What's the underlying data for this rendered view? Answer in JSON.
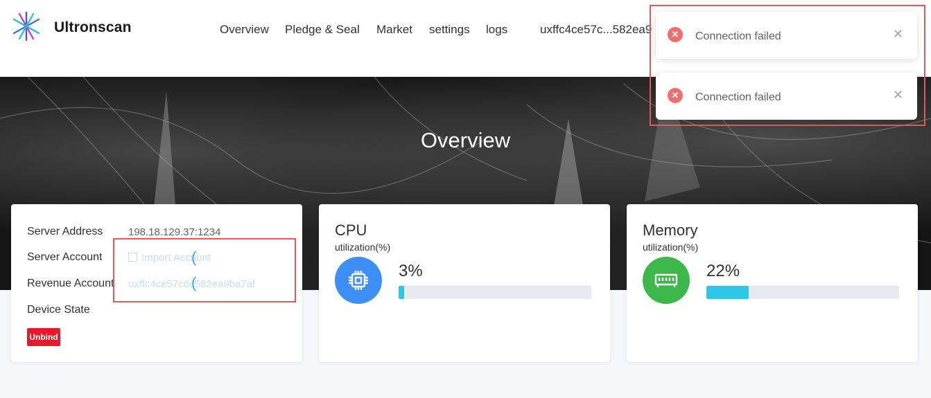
{
  "header": {
    "brand": "Ultronscan",
    "nav": [
      "Overview",
      "Pledge & Seal",
      "Market",
      "settings",
      "logs"
    ],
    "account_short": "uxffc4ce57c...582ea9"
  },
  "hero": {
    "title": "Overview"
  },
  "server_card": {
    "server_address_label": "Server Address",
    "server_address_value": "198.18.129.37:1234",
    "server_account_label": "Server Account",
    "server_account_value": "Import Account",
    "revenue_account_label": "Revenue Account",
    "revenue_account_value": "uxffc4ce57c6c582ea9ba7af",
    "device_state_label": "Device State",
    "unbind_label": "Unbind"
  },
  "cpu_card": {
    "title": "CPU",
    "subtitle": "utilization(%)",
    "value_text": "3%",
    "percent": 3,
    "icon_color": "#3d8ff5",
    "bar_color": "#2ec7e5"
  },
  "memory_card": {
    "title": "Memory",
    "subtitle": "utilization(%)",
    "value_text": "22%",
    "percent": 22,
    "icon_color": "#3cb84a",
    "bar_color": "#2ec7e5"
  },
  "toasts": [
    {
      "message": "Connection failed",
      "type": "error"
    },
    {
      "message": "Connection failed",
      "type": "error"
    }
  ],
  "colors": {
    "error": "#f56c6c",
    "annotation": "#e85656",
    "unbind": "#e8192c"
  }
}
